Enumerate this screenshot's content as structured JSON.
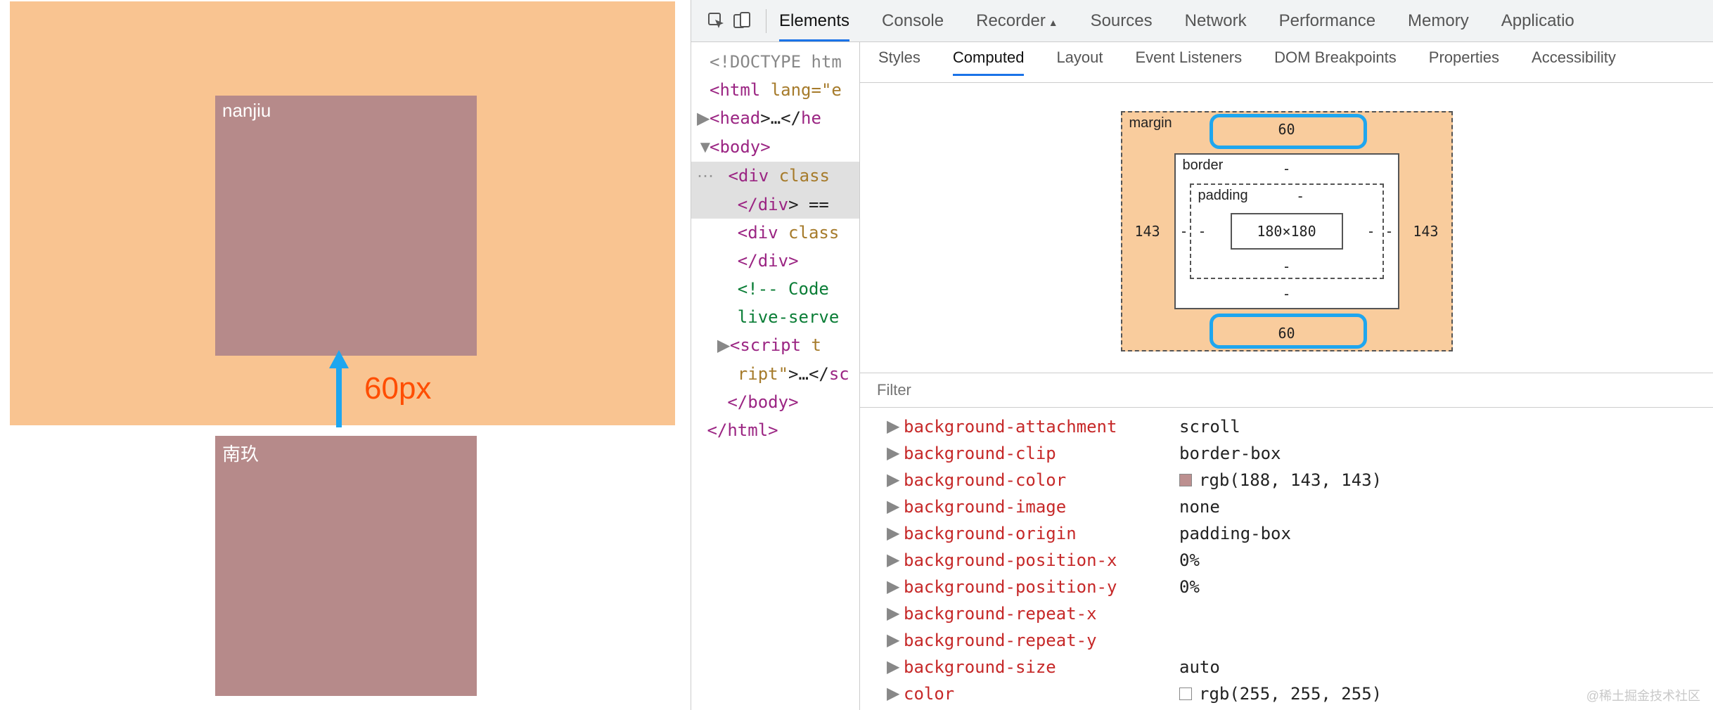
{
  "preview": {
    "box1_label": "nanjiu",
    "box2_label": "南玖",
    "arrow_label": "60px"
  },
  "toolbar": {
    "main_tabs": [
      "Elements",
      "Console",
      "Recorder",
      "Sources",
      "Network",
      "Performance",
      "Memory",
      "Applicatio"
    ],
    "main_active": 0
  },
  "side_tabs": {
    "items": [
      "Styles",
      "Computed",
      "Layout",
      "Event Listeners",
      "DOM Breakpoints",
      "Properties",
      "Accessibility"
    ],
    "active": 1
  },
  "dom_tree": {
    "doctype_line": "<!DOCTYPE htm",
    "html_open_1": "<",
    "html_open_tag": "html",
    "html_open_attr": " lang=",
    "html_open_end": "\"e",
    "head_line_pre": "<",
    "head_tag": "head",
    "head_post": ">…</",
    "head_tag2": "he",
    "body_open_pre": "<",
    "body_tag": "body",
    "body_open_post": ">",
    "div1_pre": "<",
    "div1_tag": "div",
    "div1_attr": " class",
    "div1_close_pre": "</",
    "div1_close_tag": "div",
    "div1_close_post": "> ==",
    "div2_pre": "<",
    "div2_tag": "div",
    "div2_attr": " class",
    "div2_close_pre": "</",
    "div2_close_tag": "div",
    "div2_close_post": ">",
    "comment_line": "<!-- Code ",
    "comment_line2": "live-serve",
    "script_pre": "<",
    "script_tag": "script",
    "script_attr": " t",
    "script_line2a": "ript\"",
    "script_line2b": ">…</",
    "script_line2c": "sc",
    "body_close_pre": "</",
    "body_close_tag": "body",
    "body_close_post": ">",
    "html_close_pre": "</",
    "html_close_tag": "html",
    "html_close_post": ">"
  },
  "box_model": {
    "margin_label": "margin",
    "border_label": "border",
    "padding_label": "padding",
    "margin_top": "60",
    "margin_bottom": "60",
    "margin_left": "143",
    "margin_right": "143",
    "border_top": "-",
    "border_bottom": "-",
    "border_left": "-",
    "border_right": "-",
    "padding_top": "-",
    "padding_bottom": "-",
    "padding_left": "-",
    "padding_right": "-",
    "content": "180×180"
  },
  "filter": {
    "placeholder": "Filter"
  },
  "computed_props": [
    {
      "name": "background-attachment",
      "value": "scroll"
    },
    {
      "name": "background-clip",
      "value": "border-box"
    },
    {
      "name": "background-color",
      "value": "rgb(188, 143, 143)",
      "swatch": "#bc8f8f"
    },
    {
      "name": "background-image",
      "value": "none"
    },
    {
      "name": "background-origin",
      "value": "padding-box"
    },
    {
      "name": "background-position-x",
      "value": "0%"
    },
    {
      "name": "background-position-y",
      "value": "0%"
    },
    {
      "name": "background-repeat-x",
      "value": ""
    },
    {
      "name": "background-repeat-y",
      "value": ""
    },
    {
      "name": "background-size",
      "value": "auto"
    },
    {
      "name": "color",
      "value": "rgb(255, 255, 255)",
      "swatch": "#ffffff"
    }
  ],
  "watermark": "@稀土掘金技术社区"
}
